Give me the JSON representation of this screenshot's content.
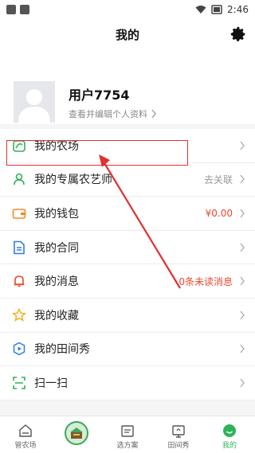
{
  "status_bar": {
    "time": "2:46"
  },
  "header": {
    "title": "我的"
  },
  "profile": {
    "username": "用户7754",
    "subtitle": "查看并编辑个人资料"
  },
  "menu": [
    {
      "label": "我的农场",
      "right": "",
      "icon": "farm-icon"
    },
    {
      "label": "我的专属农艺师",
      "right": "去关联",
      "icon": "agronomist-icon"
    },
    {
      "label": "我的钱包",
      "right": "¥0.00",
      "icon": "wallet-icon",
      "right_color": "#e84a2e"
    },
    {
      "label": "我的合同",
      "right": "",
      "icon": "contract-icon"
    },
    {
      "label": "我的消息",
      "right": "0条未读消息",
      "icon": "bell-icon",
      "right_color": "#e84a2e"
    },
    {
      "label": "我的收藏",
      "right": "",
      "icon": "star-icon"
    },
    {
      "label": "我的田间秀",
      "right": "",
      "icon": "play-icon"
    },
    {
      "label": "扫一扫",
      "right": "",
      "icon": "scan-icon"
    }
  ],
  "tabs": [
    {
      "label": "管农场",
      "icon": "home-icon"
    },
    {
      "label": "",
      "icon": "farm-center-icon"
    },
    {
      "label": "选方案",
      "icon": "map-icon"
    },
    {
      "label": "田间秀",
      "icon": "photo-icon"
    },
    {
      "label": "我的",
      "icon": "smile-icon",
      "active": true
    }
  ],
  "colors": {
    "accent": "#2fb35a",
    "highlight": "#e03131",
    "price": "#e84a2e"
  }
}
